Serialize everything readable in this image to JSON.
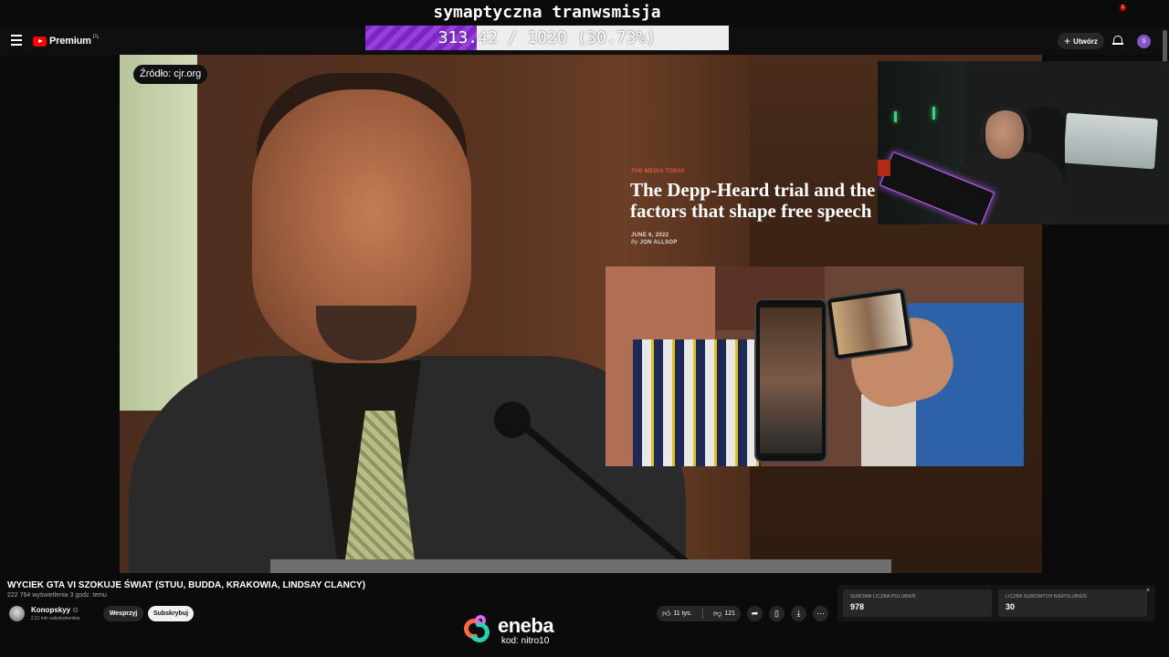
{
  "overlay": {
    "goal_title": "symaptyczna tranwsmisja",
    "goal_text": "313.42 / 1020 (30.73%)",
    "goal_progress": 0.3073,
    "goal_fill_color": "#7d24c4"
  },
  "topbar": {
    "logo_text": "Premium",
    "logo_country": "PL",
    "create_label": "Utwórz",
    "notification_count": "1",
    "avatar_letter": "S"
  },
  "video": {
    "source_label": "Źródło: cjr.org",
    "article": {
      "kicker": "THE MEDIA TODAY",
      "title": "The Depp-Heard trial and the factors that shape free speech",
      "date": "JUNE 6, 2022",
      "author_prefix": "By",
      "author": "JON ALLSOP"
    }
  },
  "info": {
    "title": "WYCIEK GTA VI SZOKUJE ŚWIAT (STUU, BUDDA, KRAKOWIA, LINDSAY CLANCY)",
    "meta": "222 764 wyświetlenia  3 godz. temu",
    "channel_name": "Konopskyy",
    "channel_subs": "2,11 mln subskrybentów",
    "support_label": "Wesprzyj",
    "subscribe_label": "Subskrybuj",
    "likes": "11 tys.",
    "dislikes": "121"
  },
  "stats": {
    "likes_label": "SUROWA LICZBA POLUBIEŃ",
    "likes_value": "978",
    "dislikes_label": "LICZBA SUROWYCH NIEPOLUBIEŃ",
    "dislikes_value": "30",
    "close": "×"
  },
  "sponsor": {
    "name": "eneba",
    "code": "kod: nitro10"
  },
  "colors": {
    "youtube_red": "#ff0000",
    "background": "#0f0f0f",
    "pill": "#272727",
    "sponsor_orange": "#ff6a3d",
    "sponsor_teal": "#25d3b0",
    "sponsor_purple": "#d86bff"
  }
}
